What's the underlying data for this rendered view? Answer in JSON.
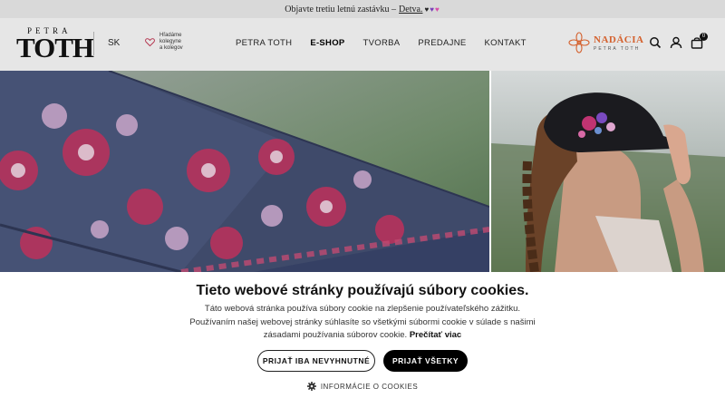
{
  "announcement": {
    "text": "Objavte tretiu letnú zastávku –",
    "link": "Detva.",
    "icons": [
      "black-heart-icon",
      "purple-heart-icon",
      "pink-heart-icon"
    ]
  },
  "header": {
    "logo": {
      "top": "PETRA",
      "main": "TOTH"
    },
    "language": "SK",
    "hiring": {
      "line1": "Hľadáme",
      "line2": "kolegyne",
      "line3": "a kolegov"
    },
    "nav": [
      "PETRA TOTH",
      "E-SHOP",
      "TVORBA",
      "PREDAJNE",
      "KONTAKT"
    ],
    "active_nav": "E-SHOP",
    "foundation": {
      "title": "NADÁCIA",
      "subtitle": "PETRA TOTH"
    },
    "icons": [
      "search-icon",
      "user-icon",
      "cart-icon"
    ],
    "cart_count": "0"
  },
  "hero": {
    "left": "umbrella-with-folk-embroidery-image",
    "right": "woman-in-embroidered-cap-image"
  },
  "cookie_banner": {
    "title": "Tieto webové stránky používajú súbory cookies.",
    "line1": "Táto webová stránka používa súbory cookie na zlepšenie používateľského zážitku.",
    "line2": "Používaním našej webovej stránky súhlasíte so všetkými súbormi cookie v súlade s našimi",
    "line3": "zásadami používania súborov cookie.",
    "read_more": "Prečítať viac",
    "accept_necessary": "PRIJAŤ IBA NEVYHNUTNÉ",
    "accept_all": "PRIJAŤ VŠETKY",
    "info": "INFORMÁCIE O COOKIES"
  },
  "colors": {
    "announcement_bg": "#d9d9d9",
    "header_bg": "#e6e6e6",
    "foundation_accent": "#d4612e",
    "button_dark": "#000000"
  }
}
